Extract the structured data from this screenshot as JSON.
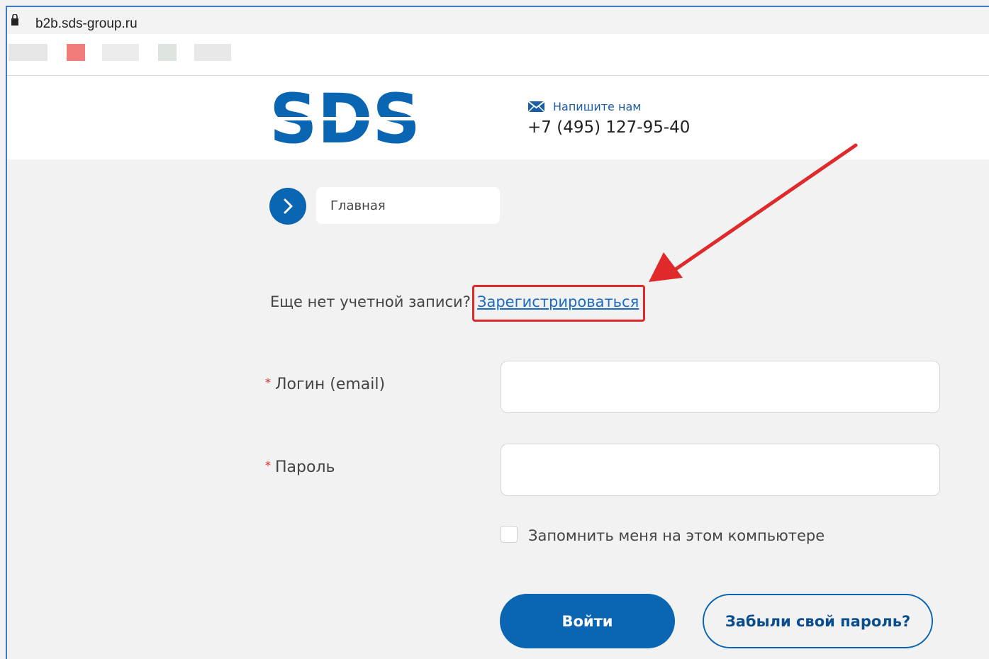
{
  "browser": {
    "url": "b2b.sds-group.ru"
  },
  "header": {
    "logo_text": "SDS",
    "write_us": "Напишите нам",
    "phone": "+7 (495) 127-95-40"
  },
  "breadcrumb": {
    "home": "Главная"
  },
  "register": {
    "question": "Еще нет учетной записи?",
    "link": "Зарегистрироваться"
  },
  "form": {
    "required_mark": "*",
    "login_label": "Логин (email)",
    "login_value": "",
    "password_label": "Пароль",
    "password_value": "",
    "remember_label": "Запомнить меня на этом компьютере",
    "remember_checked": false,
    "submit_label": "Войти",
    "forgot_label": "Забыли свой пароль?"
  },
  "colors": {
    "brand_blue": "#0a65b3",
    "annotation_red": "#e0292b",
    "link_blue": "#1b6bc1"
  },
  "icons": {
    "lock": "lock-icon",
    "mail": "mail-icon",
    "chevron": "chevron-right-icon"
  }
}
